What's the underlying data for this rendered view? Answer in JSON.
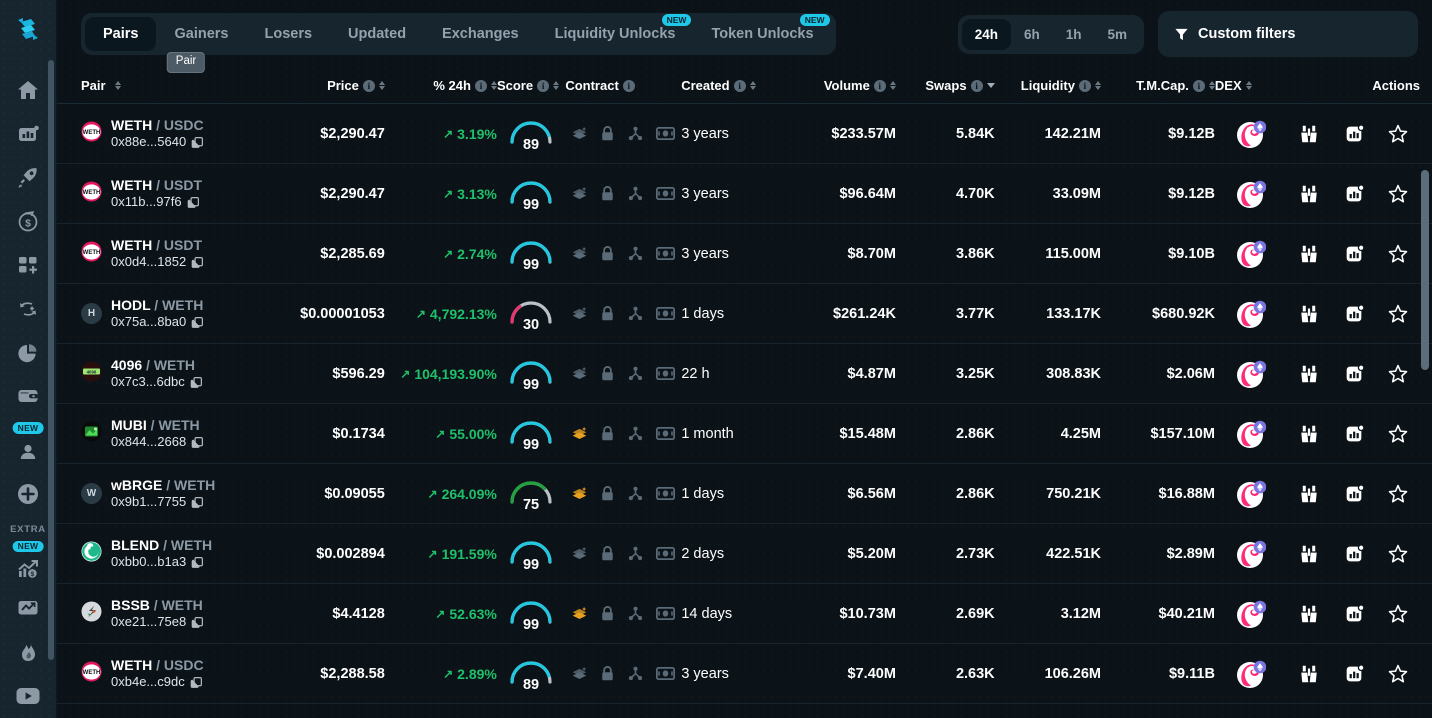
{
  "sidebar": {
    "logo": "app-logo",
    "items": [
      {
        "name": "home",
        "icon": "home-icon",
        "badge": null
      },
      {
        "name": "analytics",
        "icon": "bar-chart-icon",
        "badge": null
      },
      {
        "name": "launch",
        "icon": "rocket-icon",
        "badge": null
      },
      {
        "name": "earnings",
        "icon": "dollar-circle-icon",
        "badge": null
      },
      {
        "name": "apps",
        "icon": "grid-plus-icon",
        "badge": null
      },
      {
        "name": "swap",
        "icon": "swap-arrows-icon",
        "badge": null
      },
      {
        "name": "portfolio",
        "icon": "pie-chart-icon",
        "badge": null
      },
      {
        "name": "wallet",
        "icon": "wallet-icon",
        "badge": null
      },
      {
        "name": "profile",
        "icon": "user-icon",
        "badge": "NEW"
      },
      {
        "name": "add",
        "icon": "plus-circle-icon",
        "badge": null
      }
    ],
    "extra_label": "EXTRA",
    "extra_items": [
      {
        "name": "trending-earnings",
        "icon": "trending-dollar-icon",
        "badge": "NEW"
      },
      {
        "name": "monitor",
        "icon": "monitor-chart-icon",
        "badge": null
      },
      {
        "name": "hot",
        "icon": "fire-icon",
        "badge": null
      },
      {
        "name": "video",
        "icon": "play-video-icon",
        "badge": null
      }
    ]
  },
  "tabs": [
    {
      "label": "Pairs",
      "active": true,
      "badge": null
    },
    {
      "label": "Gainers",
      "active": false,
      "badge": null
    },
    {
      "label": "Losers",
      "active": false,
      "badge": null
    },
    {
      "label": "Updated",
      "active": false,
      "badge": null
    },
    {
      "label": "Exchanges",
      "active": false,
      "badge": null
    },
    {
      "label": "Liquidity Unlocks",
      "active": false,
      "badge": "NEW"
    },
    {
      "label": "Token Unlocks",
      "active": false,
      "badge": "NEW"
    }
  ],
  "tooltip": {
    "text": "Pair"
  },
  "periods": [
    {
      "label": "24h",
      "active": true
    },
    {
      "label": "6h",
      "active": false
    },
    {
      "label": "1h",
      "active": false
    },
    {
      "label": "5m",
      "active": false
    }
  ],
  "filters": {
    "label": "Custom filters",
    "icon": "funnel-icon"
  },
  "table": {
    "columns": [
      {
        "key": "pair",
        "label": "Pair",
        "info": false,
        "sort": true
      },
      {
        "key": "price",
        "label": "Price",
        "info": true,
        "sort": true
      },
      {
        "key": "chg",
        "label": "% 24h",
        "info": true,
        "sort": true
      },
      {
        "key": "score",
        "label": "Score",
        "info": true,
        "sort": true
      },
      {
        "key": "contract",
        "label": "Contract",
        "info": true,
        "sort": false
      },
      {
        "key": "created",
        "label": "Created",
        "info": true,
        "sort": true
      },
      {
        "key": "volume",
        "label": "Volume",
        "info": true,
        "sort": true
      },
      {
        "key": "swaps",
        "label": "Swaps",
        "info": true,
        "sort": "chevron"
      },
      {
        "key": "liquidity",
        "label": "Liquidity",
        "info": true,
        "sort": true
      },
      {
        "key": "tmcap",
        "label": "T.M.Cap.",
        "info": true,
        "sort": true
      },
      {
        "key": "dex",
        "label": "DEX",
        "info": false,
        "sort": true
      },
      {
        "key": "actions",
        "label": "Actions",
        "info": false,
        "sort": false
      }
    ],
    "rows": [
      {
        "logo": "weth",
        "logo_text": "WETH",
        "base": "WETH",
        "quote": "USDC",
        "address": "0x88e...5640",
        "price": "$2,290.47",
        "change": "3.19%",
        "score": 89,
        "score_color": "#22c8e0",
        "audit_color": "#5a6a77",
        "created": "3 years",
        "volume": "$233.57M",
        "swaps": "5.84K",
        "liquidity": "142.21M",
        "tmcap": "$9.12B",
        "dex": "uniswap"
      },
      {
        "logo": "weth",
        "logo_text": "WETH",
        "base": "WETH",
        "quote": "USDT",
        "address": "0x11b...97f6",
        "price": "$2,290.47",
        "change": "3.13%",
        "score": 99,
        "score_color": "#22c8e0",
        "audit_color": "#5a6a77",
        "created": "3 years",
        "volume": "$96.64M",
        "swaps": "4.70K",
        "liquidity": "33.09M",
        "tmcap": "$9.12B",
        "dex": "uniswap"
      },
      {
        "logo": "weth",
        "logo_text": "WETH",
        "base": "WETH",
        "quote": "USDT",
        "address": "0x0d4...1852",
        "price": "$2,285.69",
        "change": "2.74%",
        "score": 99,
        "score_color": "#22c8e0",
        "audit_color": "#5a6a77",
        "created": "3 years",
        "volume": "$8.70M",
        "swaps": "3.86K",
        "liquidity": "115.00M",
        "tmcap": "$9.10B",
        "dex": "uniswap"
      },
      {
        "logo": "letter",
        "logo_text": "H",
        "base": "HODL",
        "quote": "WETH",
        "address": "0x75a...8ba0",
        "price": "$0.00001053",
        "change": "4,792.13%",
        "score": 30,
        "score_color": "#e8356d",
        "audit_color": "#5a6a77",
        "created": "1 days",
        "volume": "$261.24K",
        "swaps": "3.77K",
        "liquidity": "133.17K",
        "tmcap": "$680.92K",
        "dex": "uniswap"
      },
      {
        "logo": "4096",
        "logo_text": "4096",
        "base": "4096",
        "quote": "WETH",
        "address": "0x7c3...6dbc",
        "price": "$596.29",
        "change": "104,193.90%",
        "score": 99,
        "score_color": "#22c8e0",
        "audit_color": "#5a6a77",
        "created": "22 h",
        "volume": "$4.87M",
        "swaps": "3.25K",
        "liquidity": "308.83K",
        "tmcap": "$2.06M",
        "dex": "uniswap"
      },
      {
        "logo": "mubi",
        "logo_text": "MUBI",
        "base": "MUBI",
        "quote": "WETH",
        "address": "0x844...2668",
        "price": "$0.1734",
        "change": "55.00%",
        "score": 99,
        "score_color": "#22c8e0",
        "audit_color": "#e8a020",
        "created": "1 month",
        "volume": "$15.48M",
        "swaps": "2.86K",
        "liquidity": "4.25M",
        "tmcap": "$157.10M",
        "dex": "uniswap"
      },
      {
        "logo": "letter",
        "logo_text": "W",
        "base": "wBRGE",
        "quote": "WETH",
        "address": "0x9b1...7755",
        "price": "$0.09055",
        "change": "264.09%",
        "score": 75,
        "score_color": "#23a03f",
        "audit_color": "#e8a020",
        "created": "1 days",
        "volume": "$6.56M",
        "swaps": "2.86K",
        "liquidity": "750.21K",
        "tmcap": "$16.88M",
        "dex": "uniswap"
      },
      {
        "logo": "blend",
        "logo_text": "BLEND",
        "base": "BLEND",
        "quote": "WETH",
        "address": "0xbb0...b1a3",
        "price": "$0.002894",
        "change": "191.59%",
        "score": 99,
        "score_color": "#22c8e0",
        "audit_color": "#5a6a77",
        "created": "2 days",
        "volume": "$5.20M",
        "swaps": "2.73K",
        "liquidity": "422.51K",
        "tmcap": "$2.89M",
        "dex": "uniswap"
      },
      {
        "logo": "bssb",
        "logo_text": "BSSB",
        "base": "BSSB",
        "quote": "WETH",
        "address": "0xe21...75e8",
        "price": "$4.4128",
        "change": "52.63%",
        "score": 99,
        "score_color": "#22c8e0",
        "audit_color": "#e8a020",
        "created": "14 days",
        "volume": "$10.73M",
        "swaps": "2.69K",
        "liquidity": "3.12M",
        "tmcap": "$40.21M",
        "dex": "uniswap"
      },
      {
        "logo": "weth",
        "logo_text": "WETH",
        "base": "WETH",
        "quote": "USDC",
        "address": "0xb4e...c9dc",
        "price": "$2,288.58",
        "change": "2.89%",
        "score": 89,
        "score_color": "#22c8e0",
        "audit_color": "#5a6a77",
        "created": "3 years",
        "volume": "$7.40M",
        "swaps": "2.63K",
        "liquidity": "106.26M",
        "tmcap": "$9.11B",
        "dex": "uniswap"
      }
    ],
    "row_icons": {
      "contract": [
        "layers-audit-icon",
        "lock-icon",
        "share-nodes-icon",
        "money-bill-icon"
      ],
      "actions": [
        "binoculars-icon",
        "chart-bars-icon",
        "star-icon"
      ]
    }
  },
  "colors": {
    "accent": "#1fc8e8",
    "positive": "#1fc06a",
    "negative": "#e8356d",
    "background": "#0c1318",
    "sidebar": "#16252e",
    "panel": "#16252e"
  }
}
